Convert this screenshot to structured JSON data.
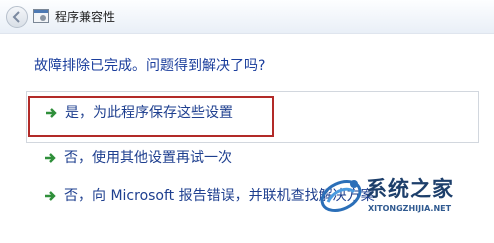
{
  "window": {
    "title": "程序兼容性"
  },
  "question": "故障排除已完成。问题得到解决了吗?",
  "options": [
    {
      "label": "是，为此程序保存这些设置"
    },
    {
      "label": "否，使用其他设置再试一次"
    },
    {
      "label": "否，向 Microsoft 报告错误，并联机查找解决方案"
    }
  ],
  "watermark": {
    "name": "系统之家",
    "url": "XITONGZHIJIA.NET"
  },
  "colors": {
    "arrow": "#2f8f3a",
    "highlight_border": "#b22a28",
    "text": "#1e3f8f"
  },
  "icons": [
    "back-arrow-icon",
    "compatibility-program-icon",
    "green-arrow-icon",
    "watermark-logo-icon"
  ]
}
